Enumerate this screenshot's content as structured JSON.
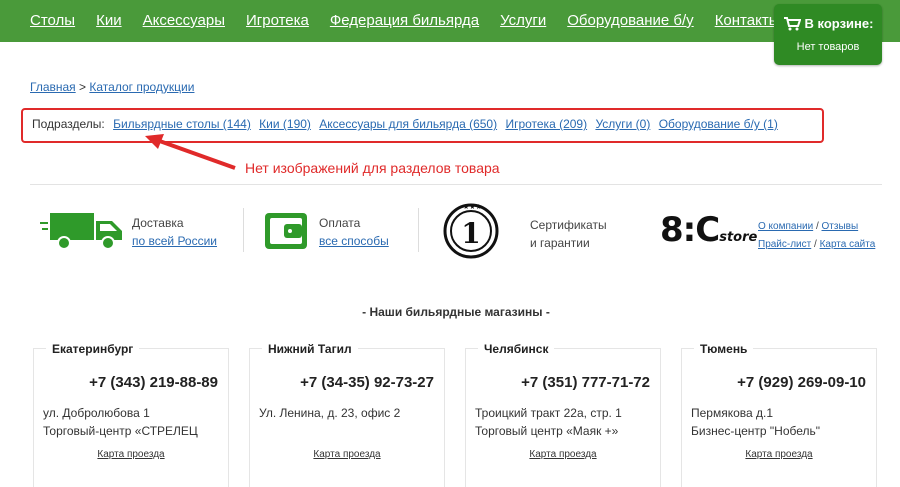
{
  "nav": {
    "items": [
      "Столы",
      "Кии",
      "Аксессуары",
      "Игротека",
      "Федерация бильярда",
      "Услуги",
      "Оборудование б/у",
      "Контакты"
    ]
  },
  "cart": {
    "title": "В корзине:",
    "status": "Нет товаров"
  },
  "breadcrumb": {
    "home": "Главная",
    "separator": ">",
    "current": "Каталог продукции"
  },
  "subsections": {
    "label": "Подразделы:",
    "items": [
      "Бильярдные столы (144)",
      "Кии (190)",
      "Аксессуары для бильярда (650)",
      "Игротека (209)",
      "Услуги (0)",
      "Оборудование б/у (1)"
    ]
  },
  "annotation": {
    "text": "Нет изображений для разделов товара",
    "color": "#e02a2a"
  },
  "features": {
    "delivery": {
      "line1": "Доставка",
      "link": "по всей России"
    },
    "payment": {
      "line1": "Оплата",
      "link": "все способы"
    },
    "certs": {
      "line1": "Сертификаты",
      "line2": "и гарантии",
      "badge": "1"
    },
    "store": {
      "logo": "8:C",
      "logo_sub": "store",
      "about": "О компании",
      "reviews": "Отзывы",
      "sep": "/",
      "pricelist": "Прайс-лист",
      "sitemap": "Карта сайта"
    }
  },
  "shops": {
    "title": "- Наши бильярдные магазины -",
    "items": [
      {
        "city": "Екатеринбург",
        "phone": "+7 (343) 219-88-89",
        "addr1": "ул. Добролюбова 1",
        "addr2": "Торговый-центр «СТРЕЛЕЦ",
        "map": "Карта проезда"
      },
      {
        "city": "Нижний Тагил",
        "phone": "+7 (34-35) 92-73-27",
        "addr1": "Ул. Ленина, д. 23, офис 2",
        "addr2": "",
        "map": "Карта проезда"
      },
      {
        "city": "Челябинск",
        "phone": "+7 (351) 777-71-72",
        "addr1": "Троицкий тракт 22а, стр. 1",
        "addr2": "Торговый центр «Маяк +»",
        "map": "Карта проезда"
      },
      {
        "city": "Тюмень",
        "phone": "+7 (929) 269-09-10",
        "addr1": "Пермякова д.1",
        "addr2": "Бизнес-центр \"Нобель\"",
        "map": "Карта проезда"
      }
    ]
  },
  "colors": {
    "nav_bg": "#4a9a3a",
    "cart_bg": "#2f8a24",
    "link": "#2a6ab1",
    "accent_red": "#e02a2a",
    "icon_green": "#2f9a2a"
  }
}
